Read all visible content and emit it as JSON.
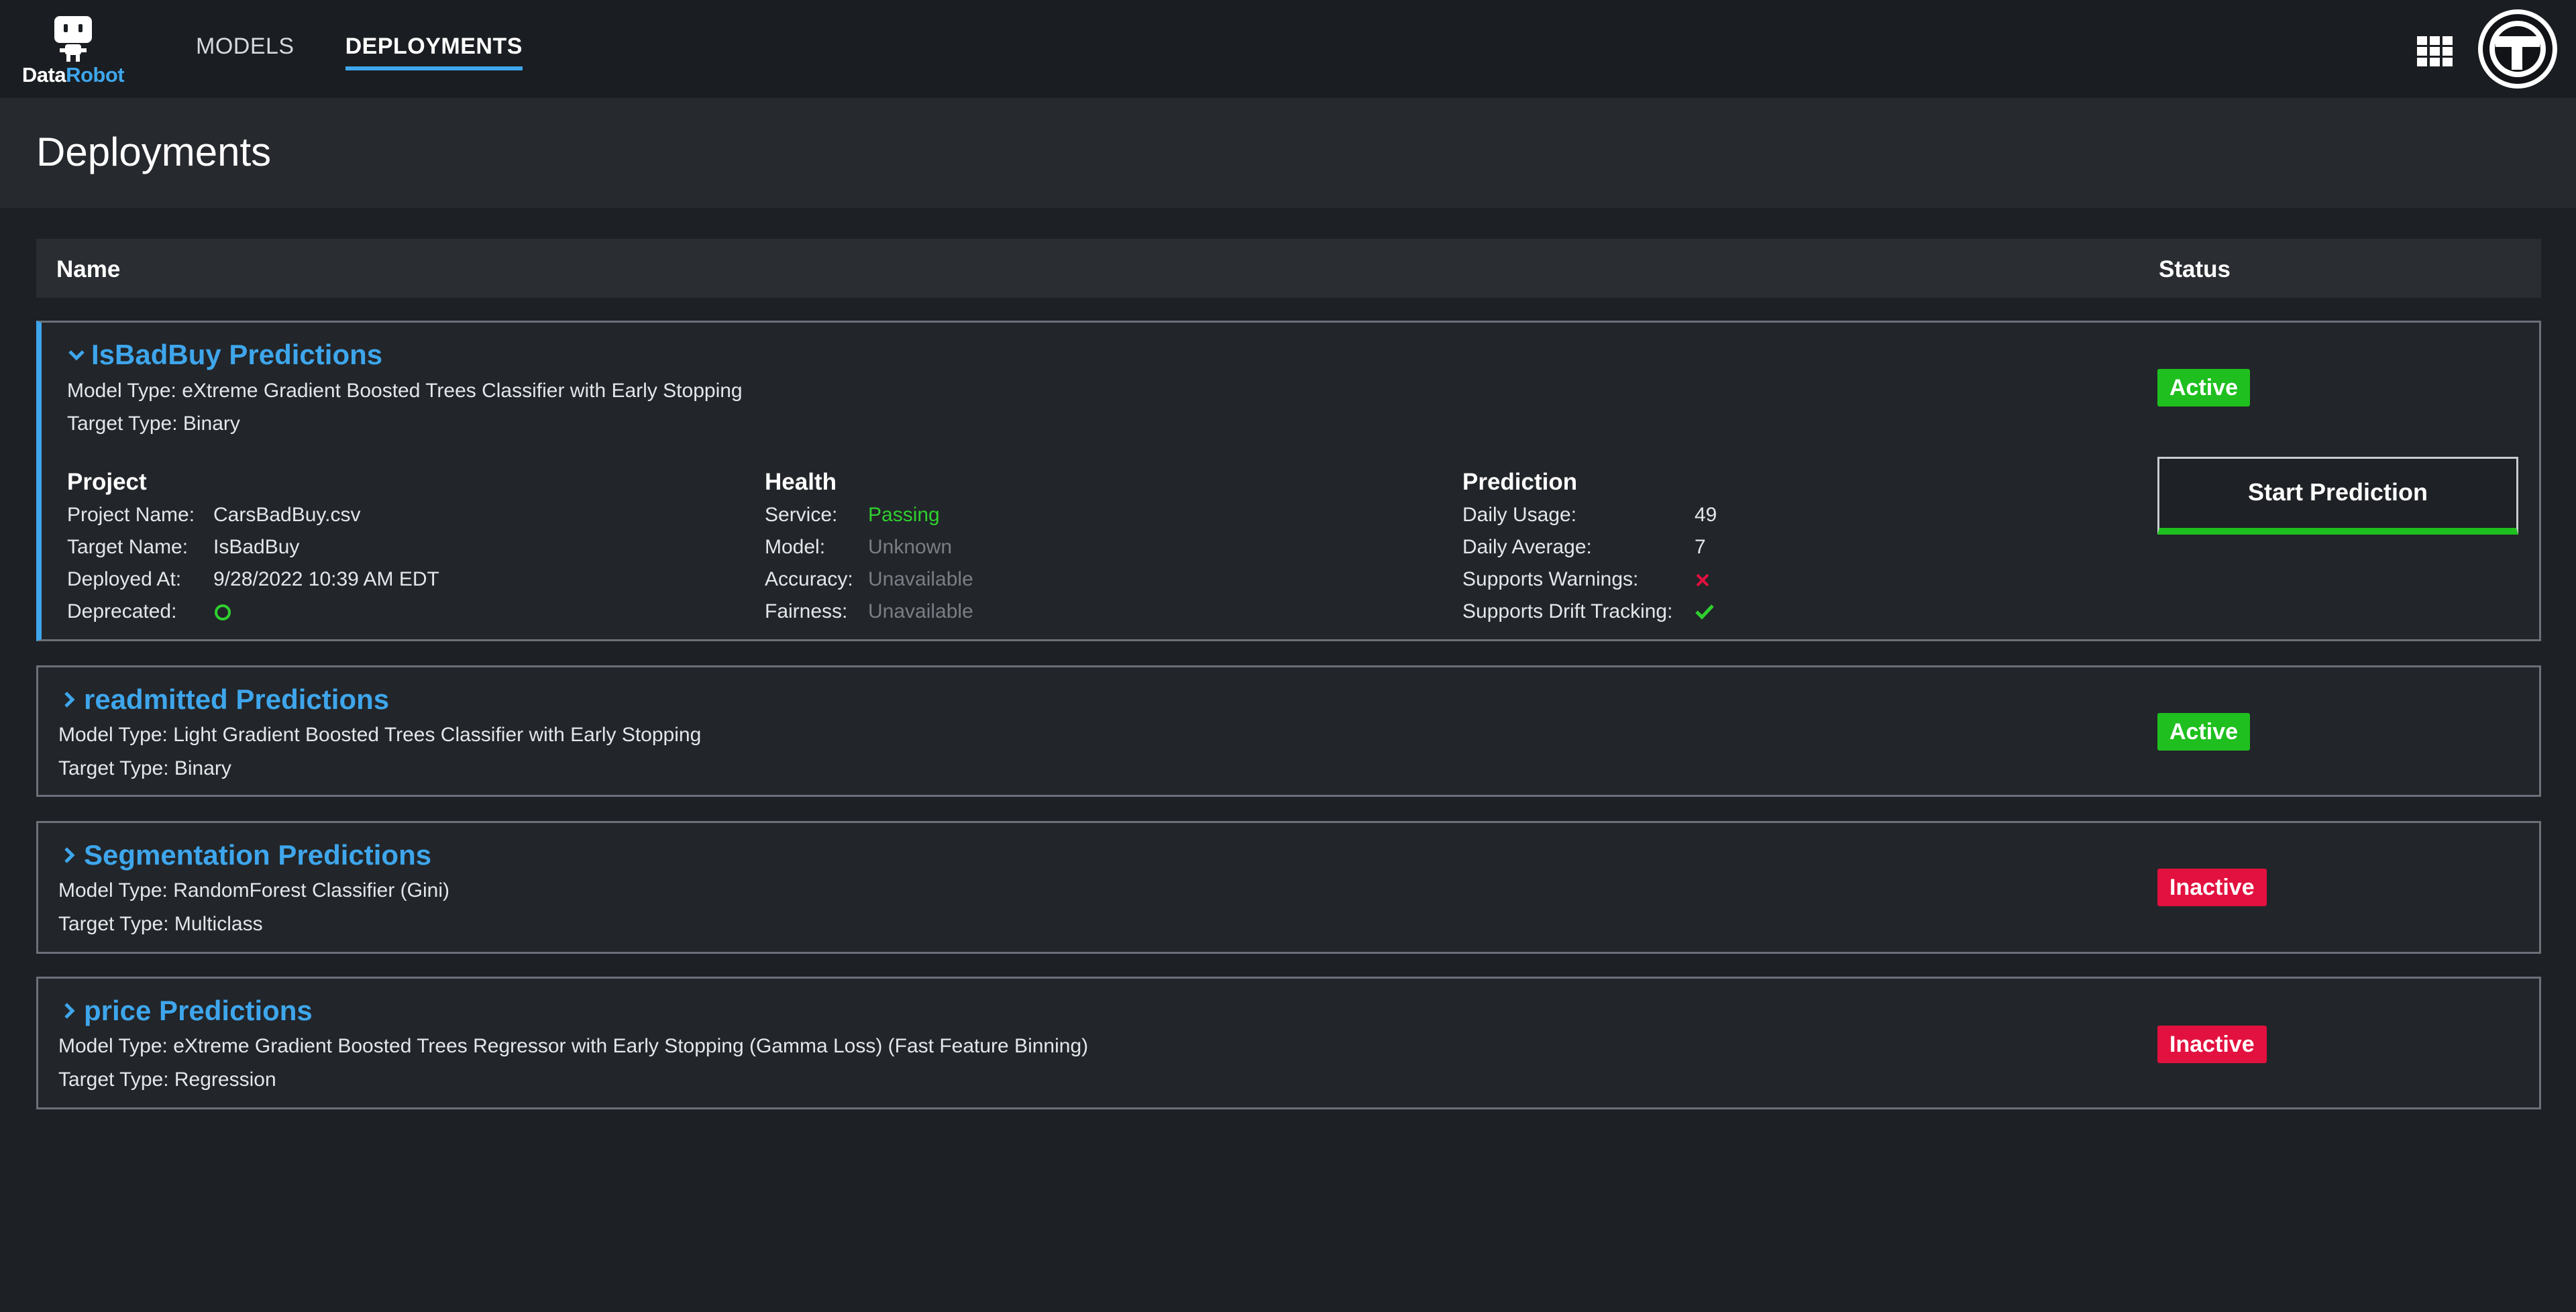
{
  "logo": {
    "text_part1": "Data",
    "text_part2": "Robot"
  },
  "nav": {
    "items": [
      {
        "label": "MODELS"
      },
      {
        "label": "DEPLOYMENTS"
      }
    ]
  },
  "page": {
    "title": "Deployments"
  },
  "table": {
    "col_name": "Name",
    "col_status": "Status"
  },
  "colors": {
    "accent": "#3ea6ec",
    "active": "#1fbf1f",
    "inactive": "#e3113f",
    "pass": "#2fd02f"
  },
  "deployments": [
    {
      "title": "IsBadBuy Predictions",
      "model_type": "Model Type: eXtreme Gradient Boosted Trees Classifier with Early Stopping",
      "target_type": "Target Type: Binary",
      "status": "Active",
      "project": {
        "heading": "Project",
        "name_label": "Project Name:",
        "name_value": "CarsBadBuy.csv",
        "target_label": "Target Name:",
        "target_value": "IsBadBuy",
        "deployed_label": "Deployed At:",
        "deployed_value": "9/28/2022 10:39 AM EDT",
        "deprecated_label": "Deprecated:",
        "deprecated_icon": "circle-icon"
      },
      "health": {
        "heading": "Health",
        "service_label": "Service:",
        "service_value": "Passing",
        "model_label": "Model:",
        "model_value": "Unknown",
        "accuracy_label": "Accuracy:",
        "accuracy_value": "Unavailable",
        "fairness_label": "Fairness:",
        "fairness_value": "Unavailable"
      },
      "prediction": {
        "heading": "Prediction",
        "daily_usage_label": "Daily Usage:",
        "daily_usage_value": "49",
        "daily_average_label": "Daily Average:",
        "daily_average_value": "7",
        "warnings_label": "Supports Warnings:",
        "warnings_icon": "x-icon",
        "drift_label": "Supports Drift Tracking:",
        "drift_icon": "checkmark-icon"
      },
      "action_label": "Start Prediction"
    },
    {
      "title": "readmitted Predictions",
      "model_type": "Model Type: Light Gradient Boosted Trees Classifier with Early Stopping",
      "target_type": "Target Type: Binary",
      "status": "Active"
    },
    {
      "title": "Segmentation Predictions",
      "model_type": "Model Type: RandomForest Classifier (Gini)",
      "target_type": "Target Type: Multiclass",
      "status": "Inactive"
    },
    {
      "title": "price Predictions",
      "model_type": "Model Type: eXtreme Gradient Boosted Trees Regressor with Early Stopping (Gamma Loss) (Fast Feature Binning)",
      "target_type": "Target Type: Regression",
      "status": "Inactive"
    }
  ]
}
